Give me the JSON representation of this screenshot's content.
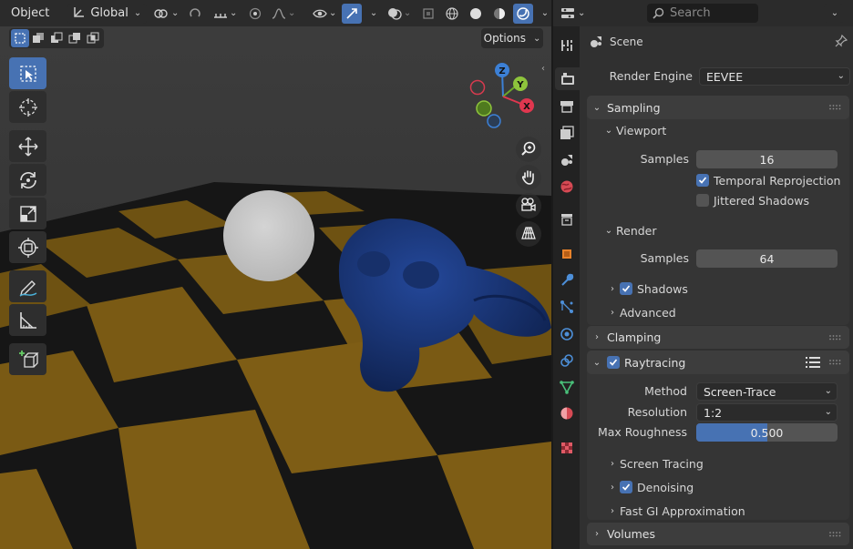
{
  "viewport": {
    "header": {
      "mode_label": "Object",
      "orientation_label": "Global"
    },
    "options_label": "Options",
    "gizmo": {
      "x": "X",
      "y": "Y",
      "z": "Z"
    }
  },
  "properties": {
    "search_placeholder": "Search",
    "context_label": "Scene",
    "render_engine": {
      "label": "Render Engine",
      "value": "EEVEE"
    },
    "sampling": {
      "title": "Sampling",
      "viewport": {
        "title": "Viewport",
        "samples_label": "Samples",
        "samples_value": "16",
        "temporal_reprojection_label": "Temporal Reprojection",
        "temporal_reprojection_checked": true,
        "jittered_shadows_label": "Jittered Shadows",
        "jittered_shadows_checked": false
      },
      "render": {
        "title": "Render",
        "samples_label": "Samples",
        "samples_value": "64"
      },
      "shadows_label": "Shadows",
      "shadows_checked": true,
      "advanced_label": "Advanced"
    },
    "clamping": {
      "title": "Clamping"
    },
    "raytracing": {
      "title": "Raytracing",
      "enabled": true,
      "method_label": "Method",
      "method_value": "Screen-Trace",
      "resolution_label": "Resolution",
      "resolution_value": "1:2",
      "max_roughness_label": "Max Roughness",
      "max_roughness_value": "0.500",
      "max_roughness_fraction": 0.5,
      "screen_tracing_label": "Screen Tracing",
      "denoising_label": "Denoising",
      "denoising_checked": true,
      "fast_gi_label": "Fast GI Approximation"
    },
    "volumes": {
      "title": "Volumes"
    }
  },
  "colors": {
    "accent": "#4772b3",
    "panel_bg": "#3d3d3d",
    "checker_yellow": "#7a5a14",
    "checker_dark": "#161616",
    "suzanne": "#1c3a7a",
    "sphere": "#c8c8c8"
  }
}
